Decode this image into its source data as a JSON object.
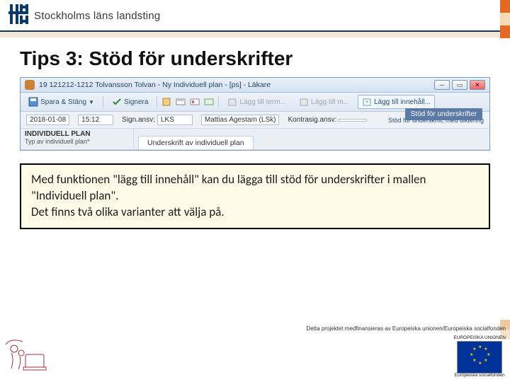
{
  "header": {
    "org_name": "Stockholms läns landsting"
  },
  "title": "Tips 3: Stöd för underskrifter",
  "app": {
    "window_title": "19 121212-1212 Tolvansson Tolvan - Ny Individuell plan - [ps] - Läkare",
    "toolbar": {
      "save_close": "Spara & Stäng",
      "sign": "Signera",
      "add_term": "Lägg till term...",
      "add_m": "Lägg till m...",
      "add_content": "Lägg till innehåll...",
      "tooltip": "Stöd för underskrifter"
    },
    "fields": {
      "date": "2018-01-08",
      "time": "15:12",
      "sign_resp_label": "Sign.ansv:",
      "sign_resp_value": "LKS",
      "name_value": "Mattias Agestam (LSk)",
      "counter_label": "Kontrasig.ansv:",
      "support_label": "Stöd för underskrift, med diktering"
    },
    "plan": {
      "heading": "INDIVIDUELL PLAN",
      "sub": "Typ av individuell plan*",
      "tab": "Underskrift av individuell plan"
    }
  },
  "callout": {
    "line1": "Med funktionen \"lägg till innehåll\" kan du lägga till stöd för underskrifter i mallen \"Individuell plan\".",
    "line2": "Det finns två olika varianter att välja på."
  },
  "footer": {
    "funding": "Detta projektet medfinansieras av Europeiska unionen/Europeiska socialfonden",
    "eu_top": "EUROPEISKA UNIONEN",
    "eu_bottom": "Europeiska socialfonden"
  }
}
